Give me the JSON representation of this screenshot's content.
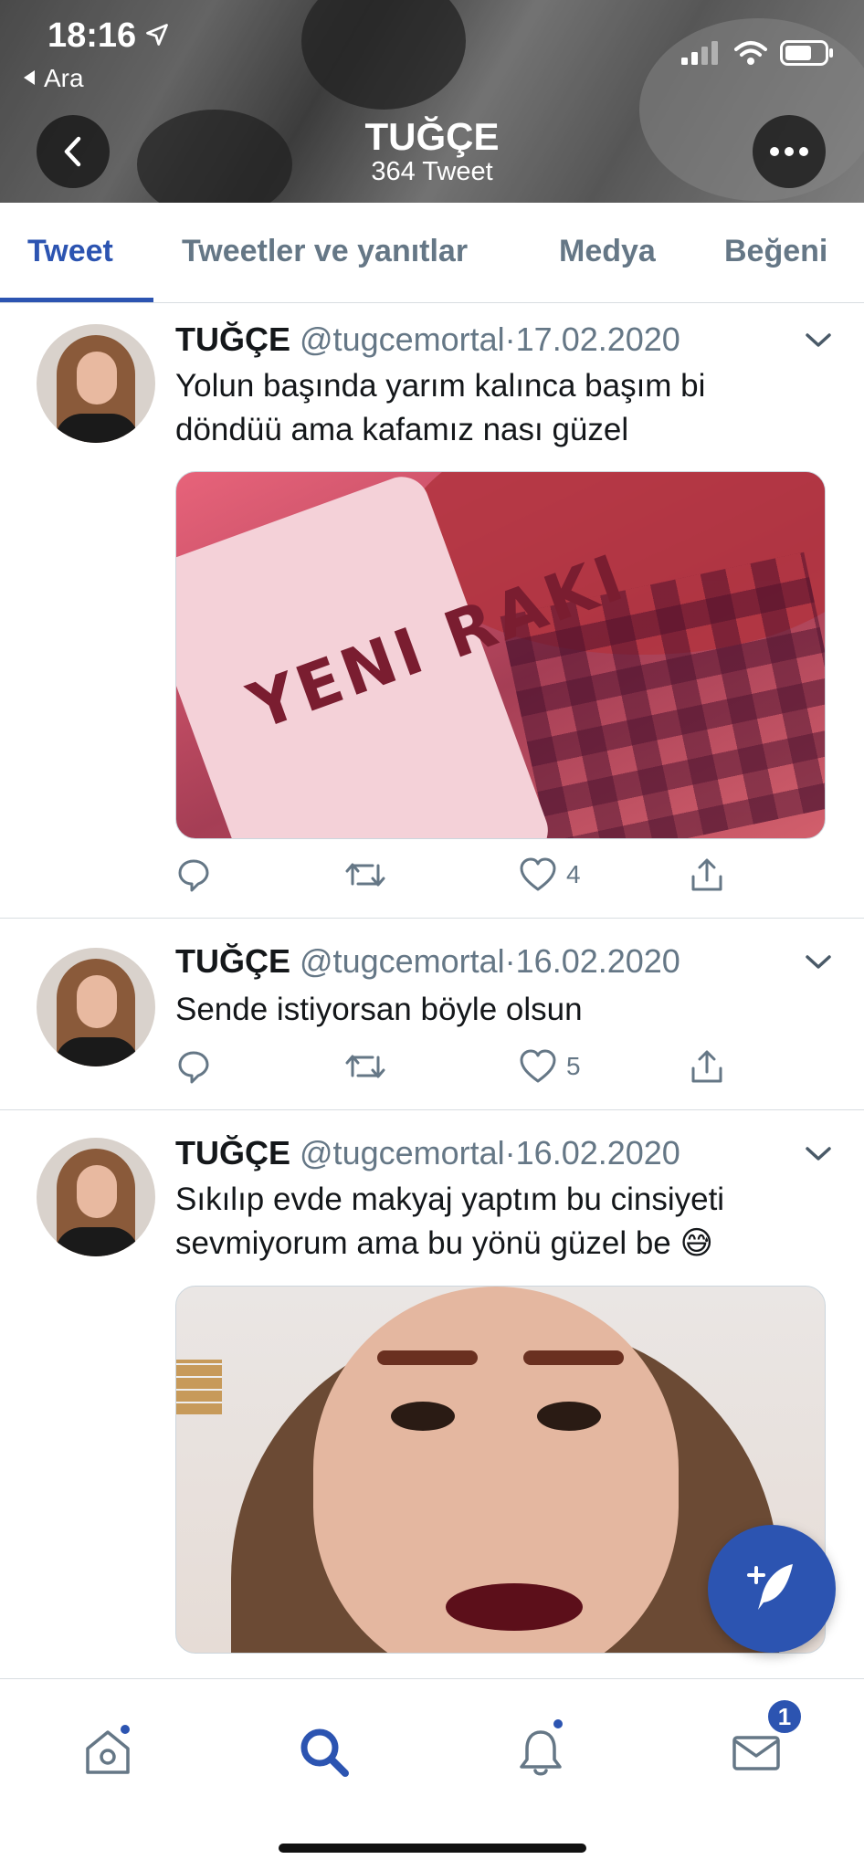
{
  "status_bar": {
    "time": "18:16",
    "back_app": "Ara"
  },
  "profile_header": {
    "name": "TUĞÇE",
    "tweet_count": "364 Tweet"
  },
  "tabs": [
    {
      "label": "Tweet",
      "active": true
    },
    {
      "label": "Tweetler ve yanıtlar",
      "active": false
    },
    {
      "label": "Medya",
      "active": false
    },
    {
      "label": "Beğeni",
      "active": false
    }
  ],
  "tweets": [
    {
      "name": "TUĞÇE",
      "handle": "@tugcemortal",
      "separator": "·",
      "date": "17.02.2020",
      "text": "Yolun başında yarım kalınca başım bi döndüü ama kafamız nası güzel",
      "media_text": "YENI RAKI",
      "likes": "4"
    },
    {
      "name": "TUĞÇE",
      "handle": "@tugcemortal",
      "separator": "·",
      "date": "16.02.2020",
      "text": "Sende istiyorsan böyle olsun",
      "likes": "5"
    },
    {
      "name": "TUĞÇE",
      "handle": "@tugcemortal",
      "separator": "·",
      "date": "16.02.2020",
      "text": "Sıkılıp evde makyaj yaptım bu cinsiyeti sevmiyorum ama bu yönü güzel be 😅"
    }
  ],
  "bottom_nav": {
    "messages_badge": "1"
  },
  "colors": {
    "accent": "#2c54b1",
    "secondary_text": "#657786",
    "divider": "#d8dde1"
  }
}
